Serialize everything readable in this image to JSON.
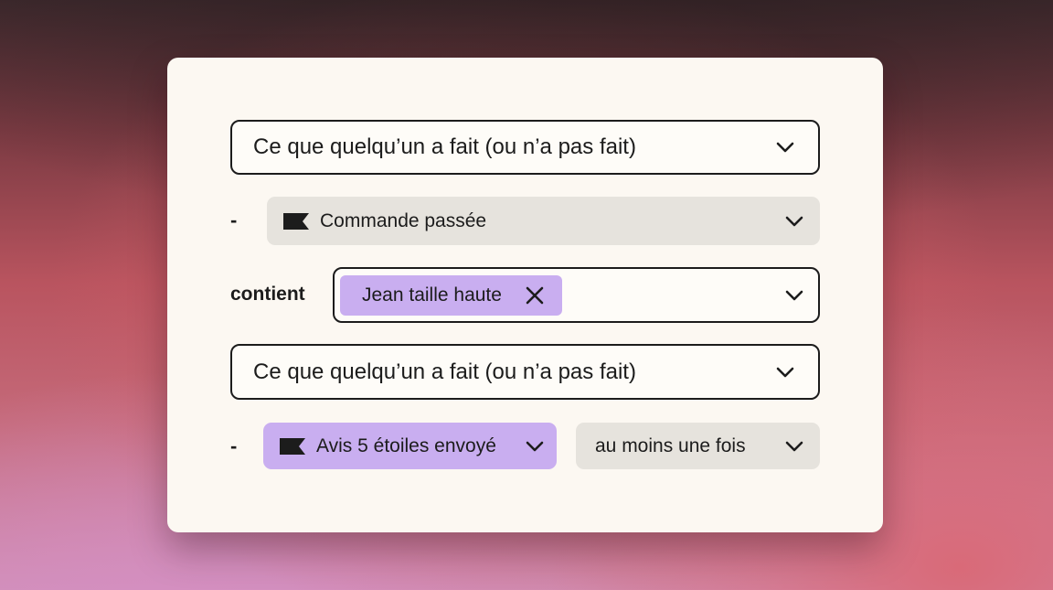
{
  "filters": {
    "condition_1": {
      "label": "Ce que quelqu’un a fait (ou n’a pas fait)",
      "icon": "chevron-down-icon"
    },
    "event_1": {
      "dash": "-",
      "label": "Commande passée",
      "icon": "flag-icon"
    },
    "property": {
      "operator_label": "contient",
      "tag_label": "Jean taille haute",
      "remove_icon": "close-icon"
    },
    "condition_2": {
      "label": "Ce que quelqu’un a fait (ou n’a pas fait)",
      "icon": "chevron-down-icon"
    },
    "event_2": {
      "dash": "-",
      "label": "Avis 5 étoiles envoyé",
      "icon": "flag-icon",
      "frequency_label": "au moins une fois"
    }
  },
  "colors": {
    "accent_purple": "#c9aef0",
    "neutral_grey": "#e6e3dd",
    "card_bg": "#fcf8f2",
    "text": "#1c1c1c"
  }
}
